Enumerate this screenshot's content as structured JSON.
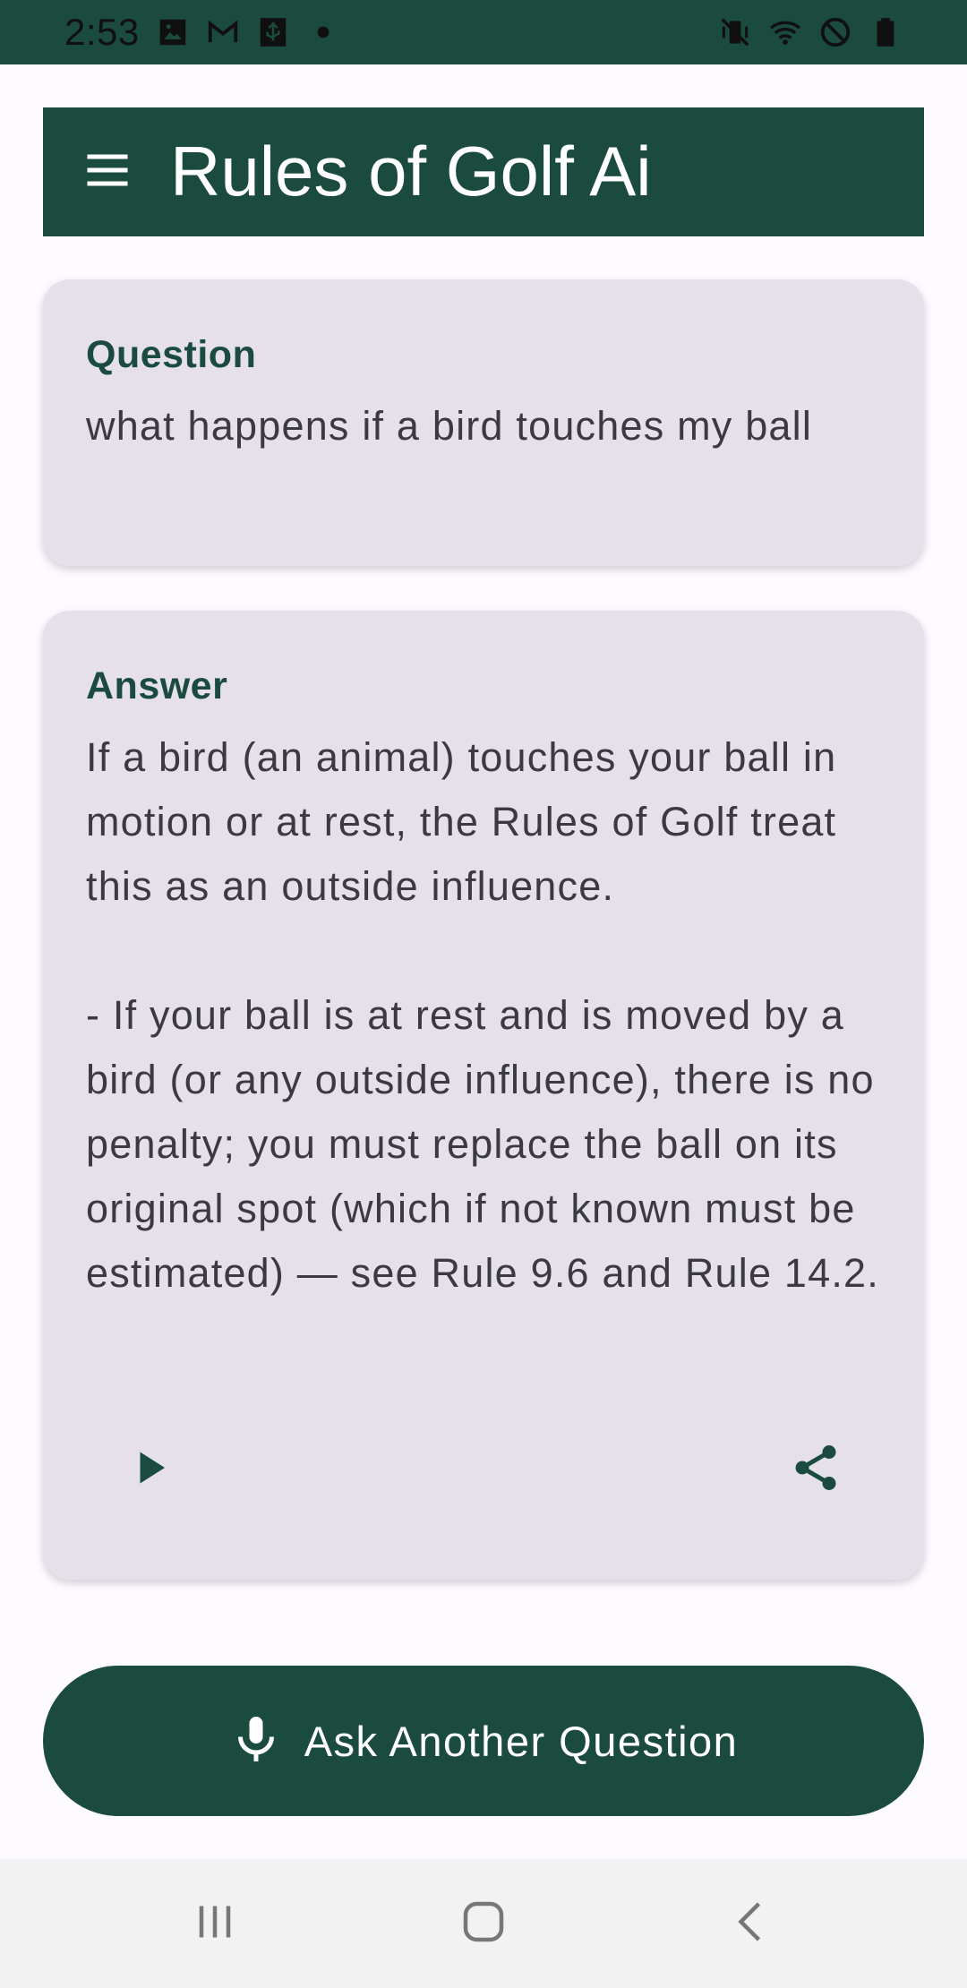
{
  "status_bar": {
    "time": "2:53",
    "left_icons": [
      "image-icon",
      "gmail-icon",
      "usb-icon",
      "dot-icon"
    ],
    "right_icons": [
      "vibrate-mute-icon",
      "wifi-icon",
      "do-not-disturb-icon",
      "battery-icon"
    ]
  },
  "app_bar": {
    "menu_icon": "menu-icon",
    "title": "Rules of Golf Ai"
  },
  "question_card": {
    "label": "Question",
    "text": "what happens if a bird touches my ball"
  },
  "answer_card": {
    "label": "Answer",
    "text": "If a bird (an animal) touches your ball in motion or at rest, the Rules of Golf treat this as an outside influence.\n\n- If your ball is at rest and is moved by a bird (or any outside influence), there is no penalty; you must replace the ball on its original spot (which if not known must be estimated) — see Rule 9.6 and Rule 14.2.",
    "play_icon": "play-icon",
    "share_icon": "share-icon"
  },
  "ask_button": {
    "icon": "microphone-icon",
    "label": "Ask Another Question"
  },
  "nav_bar": {
    "icons": [
      "recent-apps-icon",
      "home-icon",
      "back-icon"
    ]
  },
  "colors": {
    "primary": "#1b4b3f",
    "card_background": "#e6e0ea",
    "page_background": "#fdfbff",
    "text": "#3b3a40"
  }
}
